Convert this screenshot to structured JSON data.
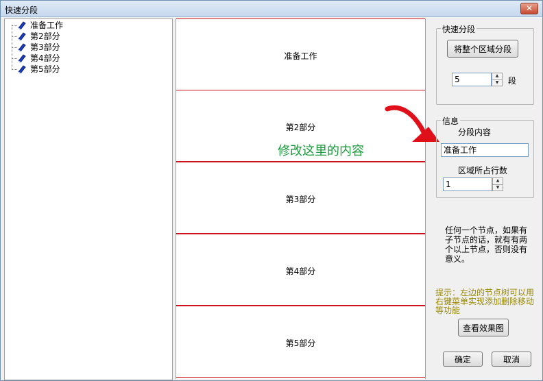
{
  "window": {
    "title": "快速分段",
    "close_glyph": "✕"
  },
  "tree": {
    "items": [
      {
        "label": "准备工作",
        "icon": "book-icon"
      },
      {
        "label": "第2部分",
        "icon": "book-icon"
      },
      {
        "label": "第3部分",
        "icon": "book-icon"
      },
      {
        "label": "第4部分",
        "icon": "book-icon"
      },
      {
        "label": "第5部分",
        "icon": "book-icon"
      }
    ]
  },
  "preview": {
    "segments": [
      "准备工作",
      "第2部分",
      "第3部分",
      "第4部分",
      "第5部分"
    ],
    "annotation": "修改这里的内容"
  },
  "quick_segment": {
    "group_title": "快速分段",
    "split_button": "将整个区域分段",
    "count_value": "5",
    "count_unit": "段"
  },
  "info": {
    "group_title": "信息",
    "content_label": "分段内容",
    "content_value": "准备工作",
    "rows_label": "区域所占行数",
    "rows_value": "1"
  },
  "description": "任何一个节点，如果有子节点的话，就有有两个以上节点，否则没有意义。",
  "hint": "提示：左边的节点树可以用右键菜单实现添加删除移动等功能",
  "buttons": {
    "preview": "查看效果图",
    "ok": "确定",
    "cancel": "取消"
  },
  "colors": {
    "segment_border": "#d0101a",
    "annotation": "#1a9a3a",
    "hint": "#9a8a00",
    "arrow": "#e0101a"
  }
}
